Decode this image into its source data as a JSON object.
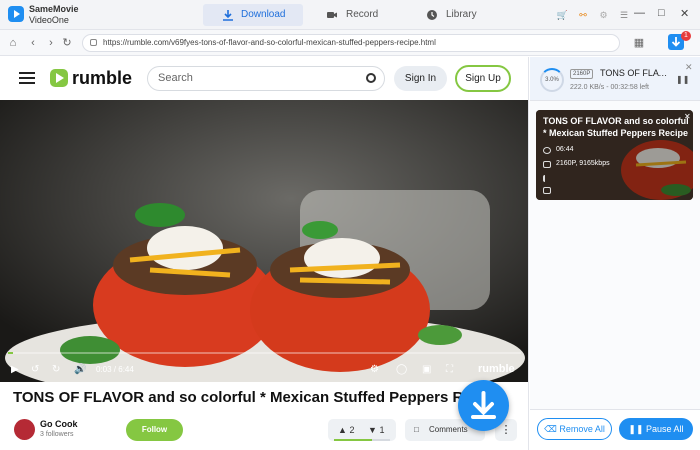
{
  "app": {
    "name": "SameMovie",
    "subtitle": "VideoOne",
    "tabs": [
      {
        "label": "Download",
        "icon": "download-icon",
        "active": true
      },
      {
        "label": "Record",
        "icon": "camera-icon",
        "active": false
      },
      {
        "label": "Library",
        "icon": "clock-icon",
        "active": false
      }
    ],
    "accent_color": "#1f8ef1"
  },
  "toolbar": {
    "url": "https://rumble.com/v69fyes-tons-of-flavor-and-so-colorful-mexican-stuffed-peppers-recipe.html",
    "download_badge_count": "1"
  },
  "rumble": {
    "logo_text": "rumble",
    "search_placeholder": "Search",
    "sign_in": "Sign In",
    "sign_up": "Sign Up",
    "brand_color": "#85c742",
    "video": {
      "current_time": "0:03",
      "duration": "6:44",
      "progress_fraction": 0.01,
      "watermark": "rumble"
    },
    "title": "TONS OF FLAVOR and so colorful * Mexican Stuffed Peppers Re",
    "channel": {
      "name": "Go Cook",
      "followers": "3 followers",
      "follow_label": "Follow"
    },
    "votes": {
      "up": "2",
      "down": "1",
      "up_fraction": 0.67
    },
    "comments_label": "Comments"
  },
  "panel": {
    "active_download": {
      "percent": "3.0%",
      "resolution": "2160P",
      "title": "TONS OF FLAVO...",
      "speed": "222.0 KB/s - 00:32:58 left"
    },
    "queued": {
      "title": "TONS OF FLAVOR and so colorful * Mexican Stuffed Peppers Recipe",
      "duration": "06:44",
      "quality": "2160P, 9165kbps"
    },
    "remove_all": "Remove All",
    "pause_all": "Pause All"
  }
}
